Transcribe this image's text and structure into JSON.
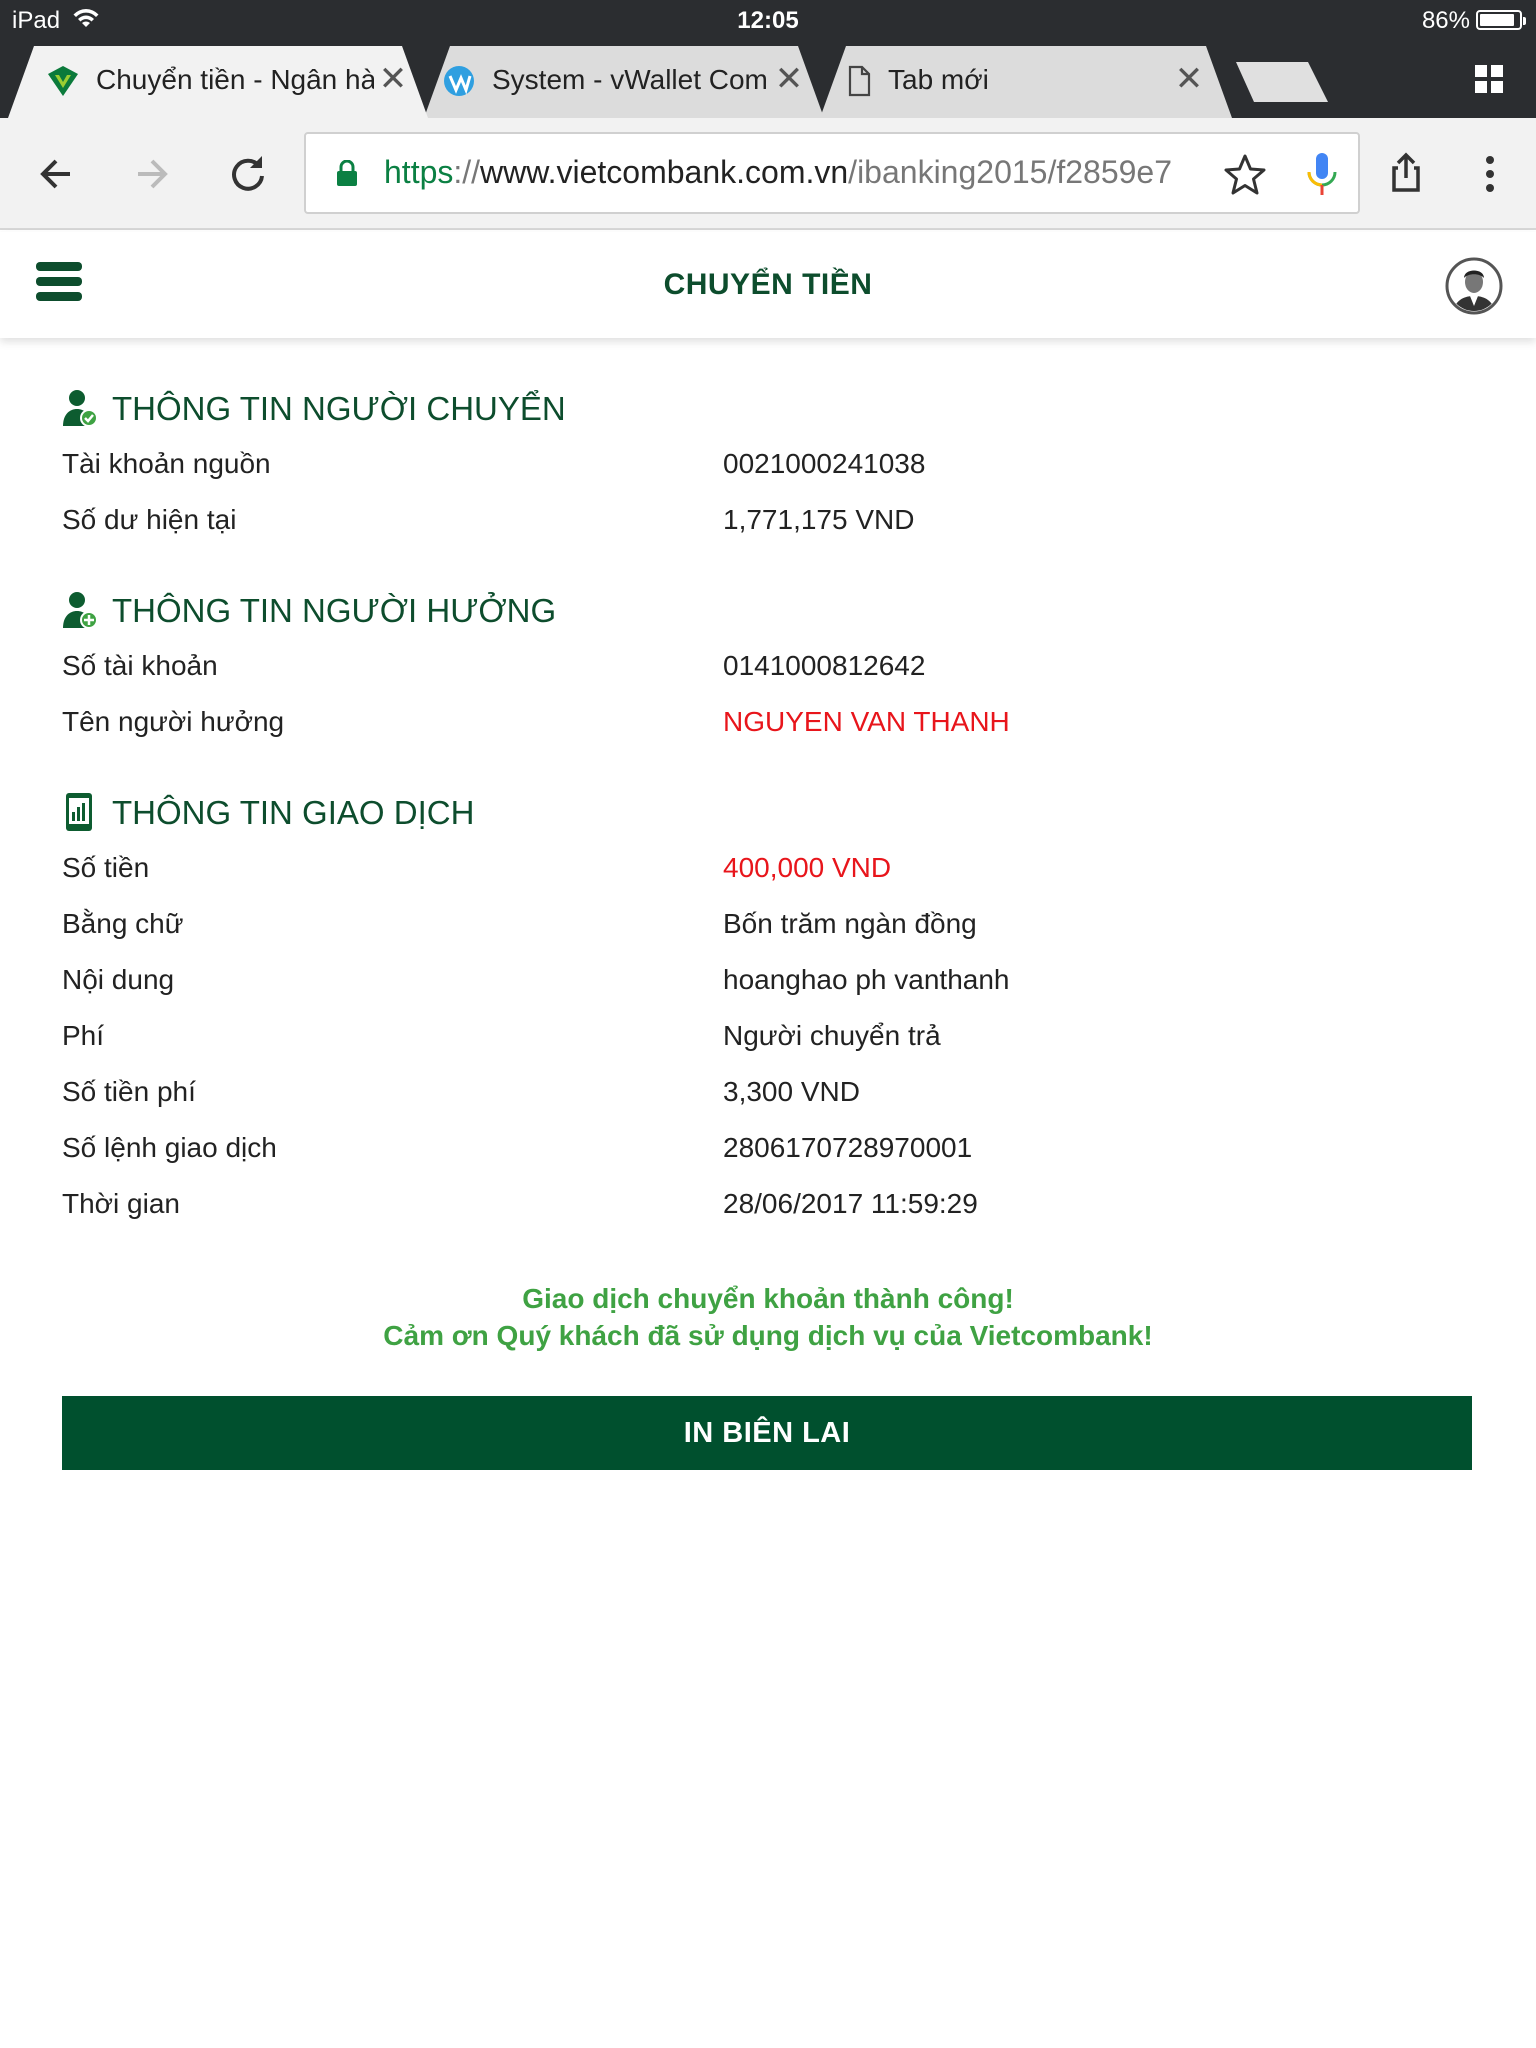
{
  "status_bar": {
    "carrier": "iPad",
    "time": "12:05",
    "battery": "86%"
  },
  "tabs": [
    {
      "title": "Chuyển tiền - Ngân hà",
      "icon": "vietcombank-logo-icon",
      "active": true
    },
    {
      "title": "System - vWallet Com",
      "icon": "vwallet-logo-icon",
      "active": false
    },
    {
      "title": "Tab mới",
      "icon": "blank-page-icon",
      "active": false
    }
  ],
  "address_bar": {
    "scheme": "https",
    "separator": "://",
    "host": "www.vietcombank.com.vn",
    "path": "/ibanking2015/f2859e7"
  },
  "header": {
    "title": "CHUYỂN TIỀN"
  },
  "sender": {
    "title": "THÔNG TIN NGƯỜI CHUYỂN",
    "rows": [
      {
        "label": "Tài khoản nguồn",
        "value": "0021000241038"
      },
      {
        "label": "Số dư hiện tại",
        "value": "1,771,175 VND"
      }
    ]
  },
  "beneficiary": {
    "title": "THÔNG TIN NGƯỜI HƯỞNG",
    "rows": [
      {
        "label": "Số tài khoản",
        "value": "0141000812642"
      },
      {
        "label": "Tên người hưởng",
        "value": "NGUYEN VAN THANH"
      }
    ]
  },
  "transaction": {
    "title": "THÔNG TIN GIAO DỊCH",
    "rows": [
      {
        "label": "Số tiền",
        "value": "400,000 VND"
      },
      {
        "label": "Bằng chữ",
        "value": "Bốn trăm ngàn đồng"
      },
      {
        "label": "Nội dung",
        "value": "hoanghao ph vanthanh"
      },
      {
        "label": "Phí",
        "value": "Người chuyển trả"
      },
      {
        "label": "Số tiền phí",
        "value": "3,300 VND"
      },
      {
        "label": "Số lệnh giao dịch",
        "value": "2806170728970001"
      },
      {
        "label": "Thời gian",
        "value": "28/06/2017 11:59:29"
      }
    ]
  },
  "message": {
    "line1": "Giao dịch chuyển khoản thành công!",
    "line2": "Cảm ơn Quý khách đã sử dụng dịch vụ của Vietcombank!"
  },
  "print_button": {
    "label": "IN BIÊN LAI"
  },
  "colors": {
    "brand_green": "#00502e",
    "heading_green": "#0d4d2d",
    "success_green": "#3fa243",
    "highlight_red": "#e8151b"
  }
}
